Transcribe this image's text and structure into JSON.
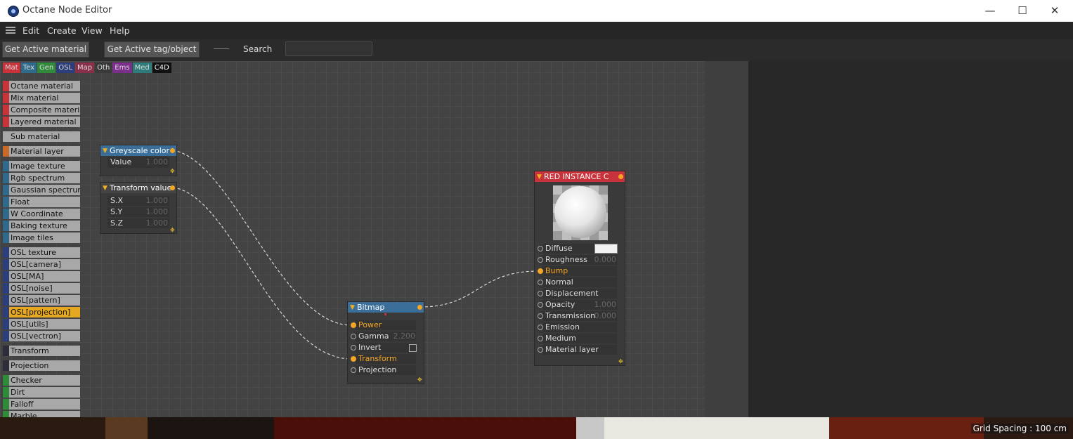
{
  "window": {
    "title": "Octane Node Editor",
    "minimize": "—",
    "maximize": "☐",
    "close": "✕"
  },
  "menu": [
    "Edit",
    "Create",
    "View",
    "Help"
  ],
  "toolbar": {
    "get_active_material": "Get Active material",
    "get_active_tag": "Get Active tag/object",
    "search_label": "Search",
    "search_value": ""
  },
  "category_tabs": [
    {
      "label": "Mat",
      "color": "#c8323a"
    },
    {
      "label": "Tex",
      "color": "#2f6a8a"
    },
    {
      "label": "Gen",
      "color": "#2f8a3a"
    },
    {
      "label": "OSL",
      "color": "#2d3f7a"
    },
    {
      "label": "Map",
      "color": "#8a2f4a"
    },
    {
      "label": "Oth",
      "color": "#3a3a3a"
    },
    {
      "label": "Ems",
      "color": "#7a2f8a"
    },
    {
      "label": "Med",
      "color": "#2f7a7a"
    },
    {
      "label": "C4D",
      "color": "#111111"
    }
  ],
  "node_list": [
    {
      "label": "Octane material",
      "color": "#c8323a"
    },
    {
      "label": "Mix material",
      "color": "#c8323a"
    },
    {
      "label": "Composite material",
      "color": "#c8323a"
    },
    {
      "label": "Layered material",
      "color": "#c8323a"
    },
    {
      "label": "Sub material",
      "color": "#a8a8a8"
    },
    {
      "label": "Material layer",
      "color": "#c86a2a"
    },
    {
      "label": "Image texture",
      "color": "#2f6a8a"
    },
    {
      "label": "Rgb spectrum",
      "color": "#2f6a8a"
    },
    {
      "label": "Gaussian spectrum",
      "color": "#2f6a8a"
    },
    {
      "label": "Float",
      "color": "#2f6a8a"
    },
    {
      "label": "W Coordinate",
      "color": "#2f6a8a"
    },
    {
      "label": "Baking texture",
      "color": "#2f6a8a"
    },
    {
      "label": "Image tiles",
      "color": "#2f6a8a"
    },
    {
      "label": "OSL texture",
      "color": "#2d3f7a"
    },
    {
      "label": "OSL[camera]",
      "color": "#2d3f7a"
    },
    {
      "label": "OSL[MA]",
      "color": "#2d3f7a"
    },
    {
      "label": "OSL[noise]",
      "color": "#2d3f7a"
    },
    {
      "label": "OSL[pattern]",
      "color": "#2d3f7a"
    },
    {
      "label": "OSL[projection]",
      "color": "#2d3f7a",
      "active": true
    },
    {
      "label": "OSL[utils]",
      "color": "#2d3f7a"
    },
    {
      "label": "OSL[vectron]",
      "color": "#2d3f7a"
    },
    {
      "label": "Transform",
      "color": "#2d2d3a"
    },
    {
      "label": "Projection",
      "color": "#2d2d3a"
    },
    {
      "label": "Checker",
      "color": "#2f8a3a"
    },
    {
      "label": "Dirt",
      "color": "#2f8a3a"
    },
    {
      "label": "Falloff",
      "color": "#2f8a3a"
    },
    {
      "label": "Marble",
      "color": "#2f8a3a"
    }
  ],
  "nodes": {
    "greyscale": {
      "title": "Greyscale color",
      "rows": [
        {
          "label": "Value",
          "value": "1.000"
        }
      ]
    },
    "transform_value": {
      "title": "Transform value",
      "rows": [
        {
          "label": "S.X",
          "value": "1.000"
        },
        {
          "label": "S.Y",
          "value": "1.000"
        },
        {
          "label": "S.Z",
          "value": "1.000"
        }
      ]
    },
    "bitmap": {
      "title": "Bitmap",
      "rows": [
        {
          "label": "Power",
          "value": "",
          "highlight": true,
          "connected": true
        },
        {
          "label": "Gamma",
          "value": "2.200"
        },
        {
          "label": "Invert",
          "value": "",
          "checkbox": true
        },
        {
          "label": "Transform",
          "value": "",
          "highlight": true,
          "connected": true
        },
        {
          "label": "Projection",
          "value": ""
        }
      ]
    },
    "material": {
      "title": "RED INSTANCE C",
      "rows": [
        {
          "label": "Diffuse",
          "value": "",
          "swatch": true
        },
        {
          "label": "Roughness",
          "value": "0.000"
        },
        {
          "label": "Bump",
          "value": "",
          "highlight": true,
          "connected": true
        },
        {
          "label": "Normal",
          "value": ""
        },
        {
          "label": "Displacement",
          "value": ""
        },
        {
          "label": "Opacity",
          "value": "1.000"
        },
        {
          "label": "Transmission",
          "value": "0.000"
        },
        {
          "label": "Emission",
          "value": ""
        },
        {
          "label": "Medium",
          "value": ""
        },
        {
          "label": "Material layer",
          "value": ""
        }
      ]
    }
  },
  "status": {
    "grid_spacing": "Grid Spacing : 100 cm"
  }
}
